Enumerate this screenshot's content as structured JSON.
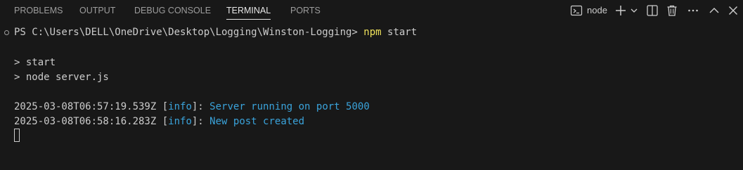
{
  "tabs": {
    "problems": "PROBLEMS",
    "output": "OUTPUT",
    "debug_console": "DEBUG CONSOLE",
    "terminal": "TERMINAL",
    "ports": "PORTS"
  },
  "active_tab": "TERMINAL",
  "terminal_instance": {
    "name": "node",
    "icons": [
      "terminal-icon",
      "plus-icon",
      "chevron-down-icon",
      "split-icon",
      "trash-icon",
      "more-icon",
      "chevron-up-icon",
      "close-icon"
    ]
  },
  "terminal": {
    "prompt": "PS C:\\Users\\DELL\\OneDrive\\Desktop\\Logging\\Winston-Logging> ",
    "command_bin": "npm",
    "command_args": " start",
    "script_line": "> start",
    "exec_line": "> node server.js",
    "logs": [
      {
        "timestamp": "2025-03-08T06:57:19.539Z",
        "bracket_open": " [",
        "level": "info",
        "bracket_close": "]: ",
        "message": "Server running on port 5000"
      },
      {
        "timestamp": "2025-03-08T06:58:16.283Z",
        "bracket_open": " [",
        "level": "info",
        "bracket_close": "]: ",
        "message": "New post created"
      }
    ]
  },
  "colors": {
    "background": "#181818",
    "text": "#cccccc",
    "command": "#f0e35c",
    "info": "#3aa3db"
  }
}
